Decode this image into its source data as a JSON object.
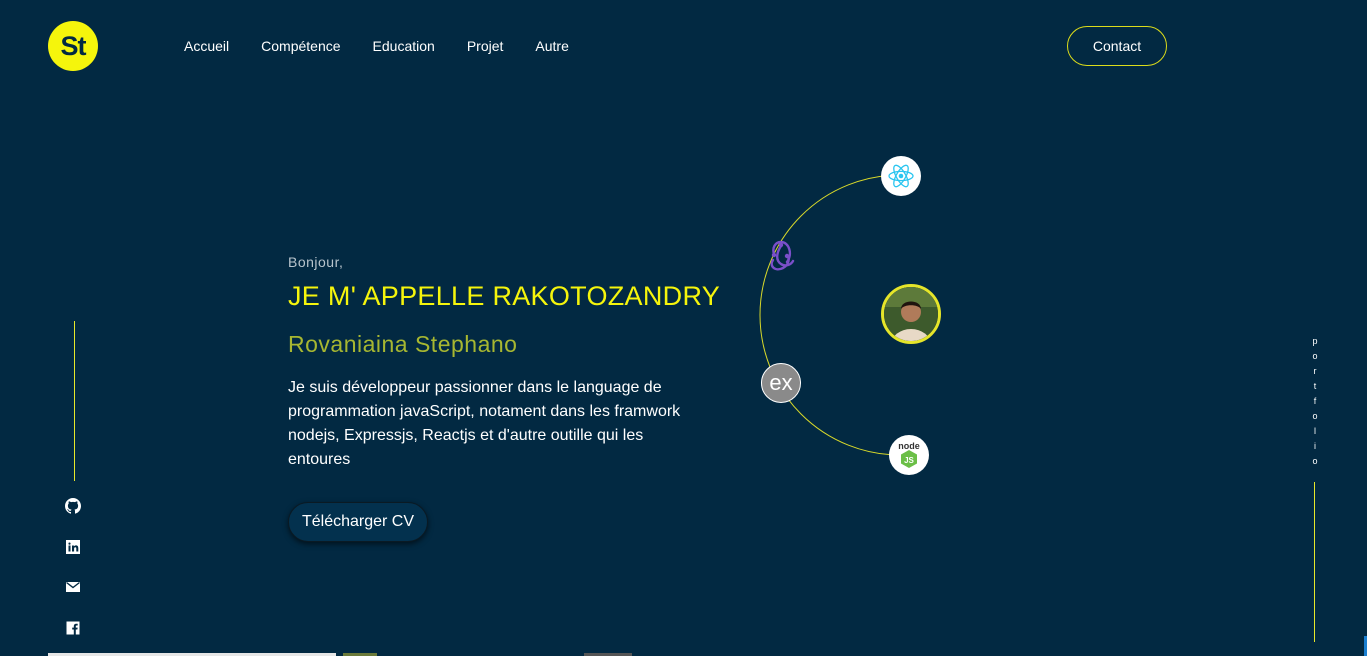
{
  "header": {
    "logo_text": "St",
    "nav": [
      "Accueil",
      "Compétence",
      "Education",
      "Projet",
      "Autre"
    ],
    "contact_label": "Contact"
  },
  "social": [
    "github-icon",
    "linkedin-icon",
    "mail-icon",
    "facebook-icon"
  ],
  "hero": {
    "greeting": "Bonjour,",
    "name": "JE M' APPELLE RAKOTOZANDRY",
    "subname": "Rovaniaina Stephano",
    "description": "Je suis développeur passionner dans le language de programmation javaScript, notament dans les framwork nodejs, Expressjs, Reactjs et d'autre outille qui les entoures",
    "cv_label": "Télécharger CV"
  },
  "orbit": {
    "icons": [
      "react-icon",
      "redux-icon",
      "avatar",
      "express-icon",
      "node-icon"
    ],
    "express_text": "ex",
    "node_text": "node",
    "node_js_text": "JS"
  },
  "side": {
    "vertical_text": "portfolio"
  },
  "colors": {
    "background": "#022942",
    "accent": "#f5f50c",
    "subname": "#a7b731"
  }
}
